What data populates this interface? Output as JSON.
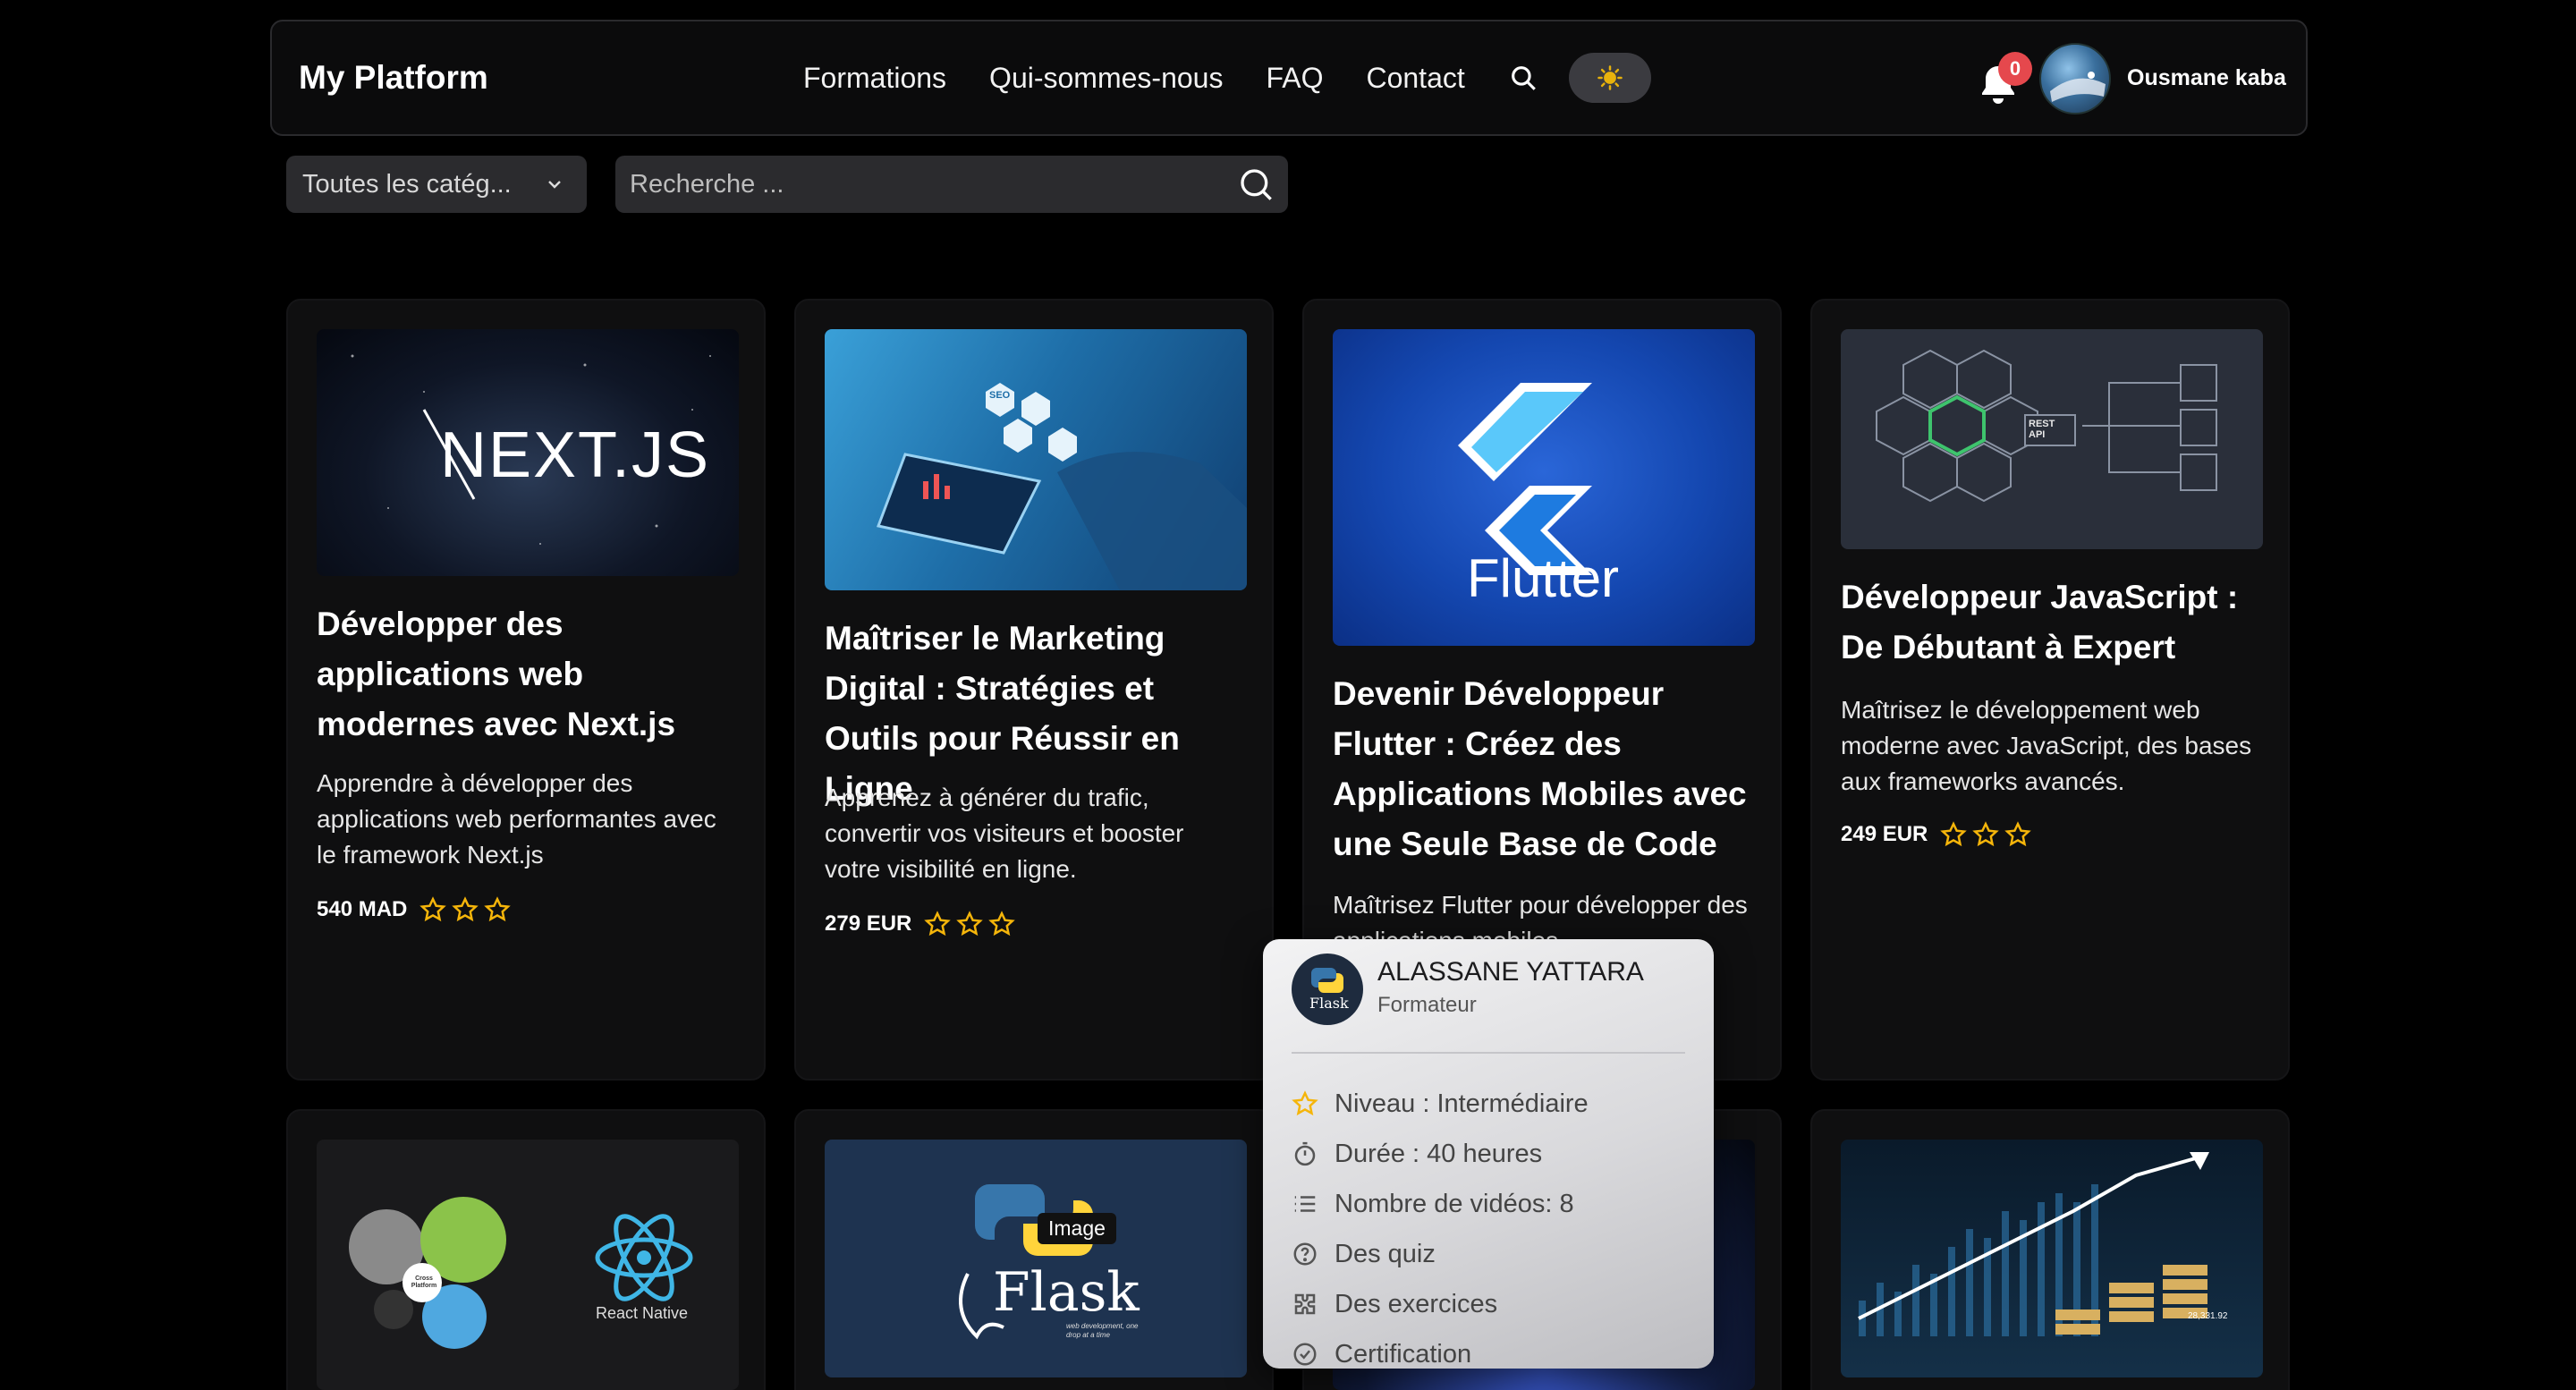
{
  "brand": "My Platform",
  "nav": {
    "links": [
      "Formations",
      "Qui-sommes-nous",
      "FAQ",
      "Contact"
    ],
    "notifications": "0",
    "user": "Ousmane kaba"
  },
  "filters": {
    "category": "Toutes les catég...",
    "search_placeholder": "Recherche ..."
  },
  "courses": [
    {
      "thumb_label": "NEXT.JS",
      "title": "Développer des applications web modernes avec Next.js",
      "desc": "Apprendre à développer des applications web performantes avec le framework Next.js",
      "price": "540 MAD"
    },
    {
      "thumb_label": "SEO",
      "title": "Maîtriser le Marketing Digital : Stratégies et Outils pour Réussir en Ligne",
      "desc": "Apprenez à générer du trafic, convertir vos visiteurs et booster votre visibilité en ligne.",
      "price": "279 EUR"
    },
    {
      "thumb_label": "Flutter",
      "title": "Devenir Développeur Flutter : Créez des Applications Mobiles avec une Seule Base de Code",
      "desc": "Maîtrisez Flutter pour développer des applications mobiles"
    },
    {
      "thumb_label": "REST API",
      "title": "Développeur JavaScript : De Débutant à Expert",
      "desc": "Maîtrisez le développement web moderne avec JavaScript, des bases aux frameworks avancés.",
      "price": "249 EUR"
    }
  ],
  "row2": {
    "react_native_label": "React Native",
    "cross_platform_label": "Cross Platform",
    "flask_label": "Flask",
    "flask_tag": "web development, one drop at a time",
    "tooltip": "Image",
    "finance_value": "28,331.92"
  },
  "popover": {
    "name": "ALASSANE YATTARA",
    "role": "Formateur",
    "avatar_label": "Flask",
    "items": [
      "Niveau : Intermédiaire",
      "Durée : 40 heures",
      "Nombre de vidéos: 8",
      "Des quiz",
      "Des exercices",
      "Certification"
    ]
  },
  "colors": {
    "star": "#f5b50a",
    "background": "#000000",
    "card": "#0f0f10",
    "badge": "#e5484d"
  }
}
